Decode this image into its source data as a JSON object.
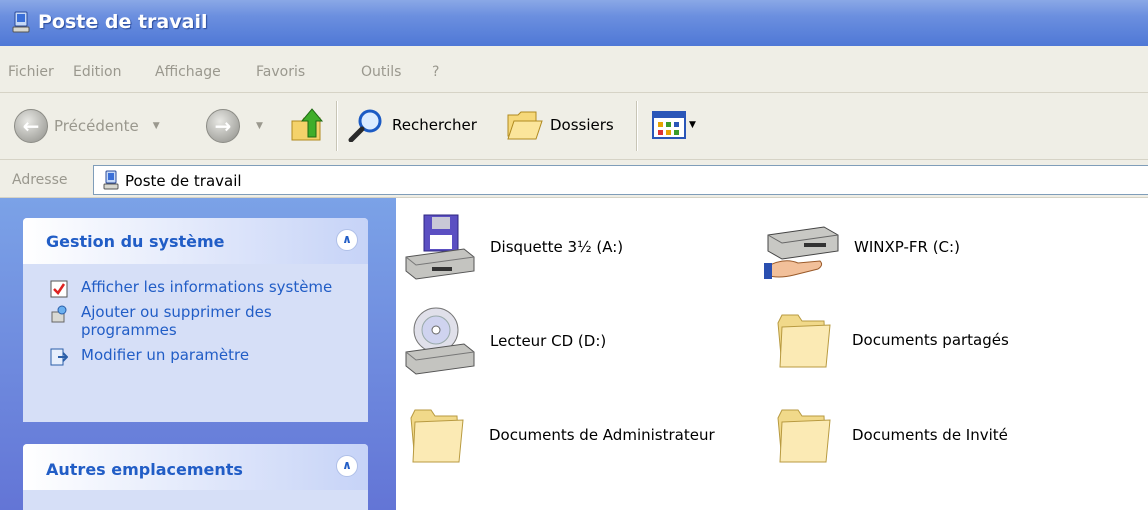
{
  "window": {
    "title": "Poste de travail"
  },
  "menu": [
    "Fichier",
    "Edition",
    "Affichage",
    "Favoris",
    "Outils",
    "?"
  ],
  "toolbar": {
    "back_label": "Précédente",
    "search_label": "Rechercher",
    "folders_label": "Dossiers"
  },
  "address": {
    "label": "Adresse",
    "value": "Poste de travail"
  },
  "sidebar": {
    "system_tasks": {
      "title": "Gestion du système",
      "items": [
        {
          "label": "Afficher les informations système",
          "icon": "system-info-icon"
        },
        {
          "label": "Ajouter ou supprimer des programmes",
          "icon": "add-remove-programs-icon"
        },
        {
          "label": "Modifier un paramètre",
          "icon": "control-panel-icon"
        }
      ]
    },
    "other_places": {
      "title": "Autres emplacements"
    }
  },
  "items": [
    {
      "label": "Disquette 3½ (A:)",
      "icon": "floppy-drive-icon"
    },
    {
      "label": "WINXP-FR (C:)",
      "icon": "shared-hard-drive-icon"
    },
    {
      "label": "Lecteur CD (D:)",
      "icon": "cd-drive-icon"
    },
    {
      "label": "Documents partagés",
      "icon": "folder-icon"
    },
    {
      "label": "Documents de Administrateur",
      "icon": "folder-icon"
    },
    {
      "label": "Documents de Invité",
      "icon": "folder-icon"
    }
  ],
  "colors": {
    "titlebar": "#4f78d6",
    "sidebar": "#6b8fe0",
    "link": "#215dc6"
  }
}
